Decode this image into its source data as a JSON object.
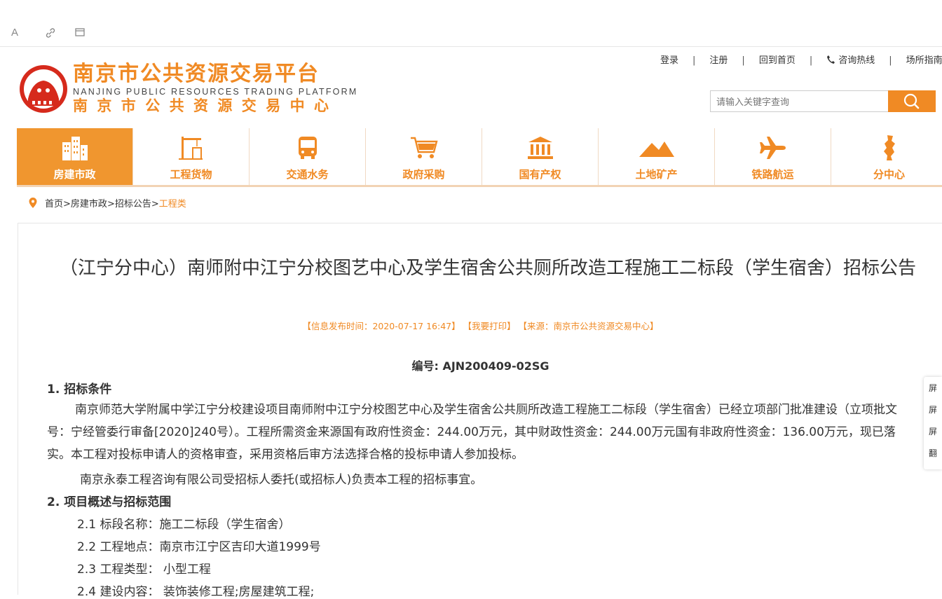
{
  "toolbar": {
    "font_icon": "A",
    "link_icon": "link-icon",
    "window_icon": "window-icon"
  },
  "brand": {
    "name_cn": "南京市公共资源交易平台",
    "name_en": "NANJING PUBLIC RESOURCES TRADING PLATFORM",
    "center_cn": "南京市公共资源交易中心"
  },
  "top_links": {
    "login": "登录",
    "register": "注册",
    "home": "回到首页",
    "hotline": "咨询热线",
    "guide": "场所指南"
  },
  "search": {
    "placeholder": "请输入关键字查询",
    "value": ""
  },
  "nav": [
    {
      "label": "房建市政",
      "icon": "buildings-icon",
      "active": true
    },
    {
      "label": "工程货物",
      "icon": "crane-icon"
    },
    {
      "label": "交通水务",
      "icon": "bus-icon"
    },
    {
      "label": "政府采购",
      "icon": "cart-icon"
    },
    {
      "label": "国有产权",
      "icon": "bank-icon"
    },
    {
      "label": "土地矿产",
      "icon": "mountain-icon"
    },
    {
      "label": "铁路航运",
      "icon": "plane-icon"
    },
    {
      "label": "分中心",
      "icon": "sub-center-icon"
    }
  ],
  "breadcrumb": {
    "home": "首页",
    "sep": ">",
    "c1": "房建市政",
    "c2": "招标公告",
    "current": "工程类"
  },
  "article": {
    "title": "（江宁分中心）南师附中江宁分校图艺中心及学生宿舍公共厕所改造工程施工二标段（学生宿舍）招标公告",
    "meta": "【信息发布时间：2020-07-17 16:47】 【我要打印】 【来源：南京市公共资源交易中心】",
    "code": "编号: AJN200409-02SG",
    "h1": "1. 招标条件",
    "p1": "南京师范大学附属中学江宁分校建设项目南师附中江宁分校图艺中心及学生宿舍公共厕所改造工程施工二标段（学生宿舍）已经立项部门批准建设（立项批文号：宁经管委行审备[2020]240号）。工程所需资金来源国有政府性资金：244.00万元，其中财政性资金：244.00万元国有非政府性资金：136.00万元，现已落实。本工程对投标申请人的资格审查，采用资格后审方法选择合格的投标申请人参加投标。",
    "p2": "南京永泰工程咨询有限公司受招标人委托(或招标人)负责本工程的招标事宜。",
    "h2": "2. 项目概述与招标范围",
    "l1": "2.1 标段名称：施工二标段（学生宿舍）",
    "l2": "2.2 工程地点：南京市江宁区吉印大道1999号",
    "l3": "2.3 工程类型： 小型工程",
    "l4": "2.4 建设内容： 装饰装修工程;房屋建筑工程;"
  },
  "sidebar": [
    "屏",
    "屏",
    "屏",
    "翻"
  ]
}
